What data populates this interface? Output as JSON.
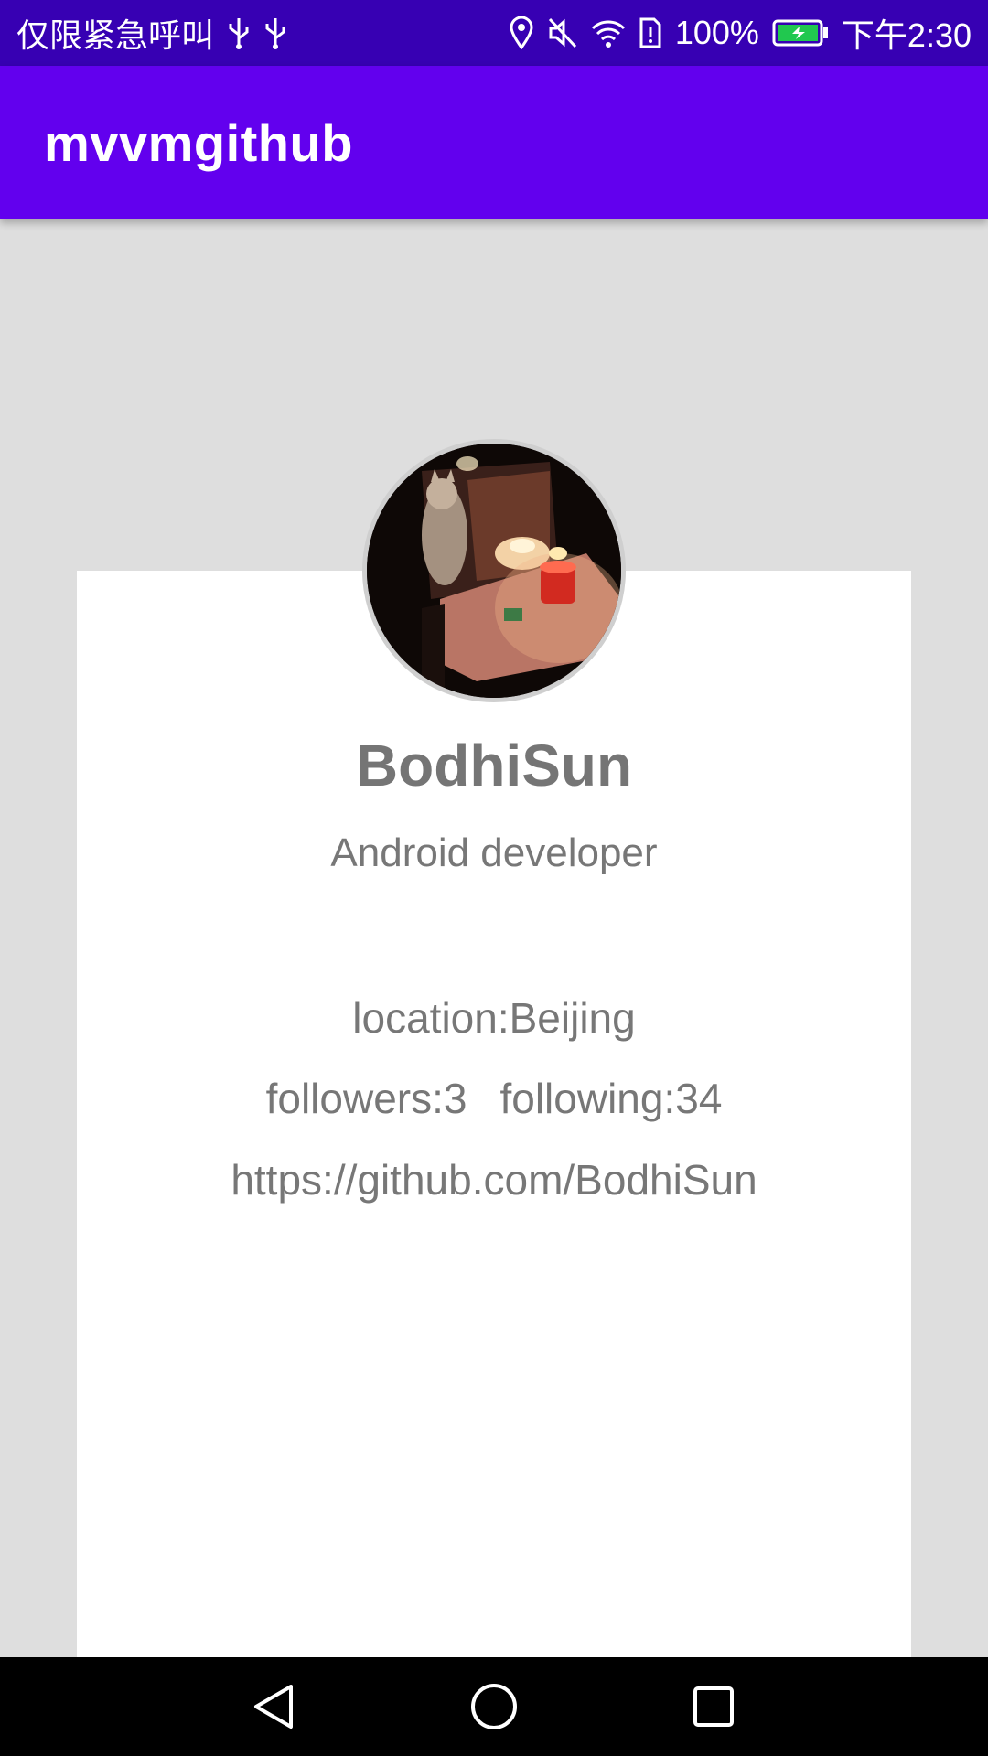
{
  "status_bar": {
    "carrier_text": "仅限紧急呼叫",
    "battery_percent": "100%",
    "time": "下午2:30",
    "icons": [
      "usb-icon",
      "usb-icon",
      "location-icon",
      "mute-icon",
      "wifi-icon",
      "sim-icon",
      "battery-icon"
    ]
  },
  "app_bar": {
    "title": "mvvmgithub"
  },
  "profile": {
    "name": "BodhiSun",
    "bio": "Android developer",
    "location": "location:Beijing",
    "followers": "followers:3",
    "following": "following:34",
    "url": "https://github.com/BodhiSun"
  },
  "nav_bar": {
    "buttons": [
      "back-icon",
      "home-icon",
      "recents-icon"
    ]
  },
  "colors": {
    "status_bar": "#3700b3",
    "app_bar": "#6200ee",
    "background": "#dedede",
    "card": "#ffffff",
    "text": "#777777"
  }
}
